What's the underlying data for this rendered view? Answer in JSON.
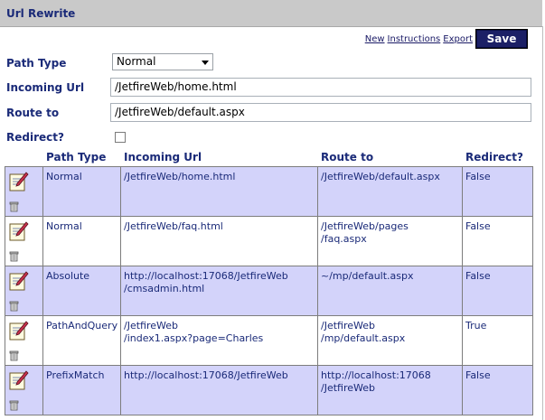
{
  "panel": {
    "title": "Url Rewrite"
  },
  "toolbar": {
    "links": [
      "New",
      "Instructions",
      "Export"
    ],
    "save_label": "Save"
  },
  "form": {
    "path_type_label": "Path Type",
    "path_type_value": "Normal",
    "incoming_label": "Incoming Url",
    "incoming_value": "/JetfireWeb/home.html",
    "route_label": "Route to",
    "route_value": "/JetfireWeb/default.aspx",
    "redirect_label": "Redirect?"
  },
  "table": {
    "headers": [
      "Path Type",
      "Incoming Url",
      "Route to",
      "Redirect?"
    ],
    "rows": [
      {
        "path_type": "Normal",
        "incoming": [
          "/JetfireWeb/home.html"
        ],
        "route": [
          "/JetfireWeb/default.aspx"
        ],
        "redirect": "False"
      },
      {
        "path_type": "Normal",
        "incoming": [
          "/JetfireWeb/faq.html"
        ],
        "route": [
          "/JetfireWeb/pages",
          "/faq.aspx"
        ],
        "redirect": "False"
      },
      {
        "path_type": "Absolute",
        "incoming": [
          "http://localhost:17068/JetfireWeb",
          "/cmsadmin.html"
        ],
        "route": [
          "~/mp/default.aspx"
        ],
        "redirect": "False"
      },
      {
        "path_type": "PathAndQuery",
        "incoming": [
          "/JetfireWeb",
          "/index1.aspx?page=Charles"
        ],
        "route": [
          "/JetfireWeb",
          "/mp/default.aspx"
        ],
        "redirect": "True"
      },
      {
        "path_type": "PrefixMatch",
        "incoming": [
          "http://localhost:17068/JetfireWeb"
        ],
        "route": [
          "http://localhost:17068",
          "/JetfireWeb"
        ],
        "redirect": "False"
      }
    ]
  },
  "icons": {
    "edit": "edit-note-icon",
    "delete": "trash-can-icon"
  },
  "colors": {
    "title_bar": "#c9c9c9",
    "label_text": "#1a2a78",
    "save_button": "#1c2066",
    "alt_row": "#d3d3fa"
  }
}
